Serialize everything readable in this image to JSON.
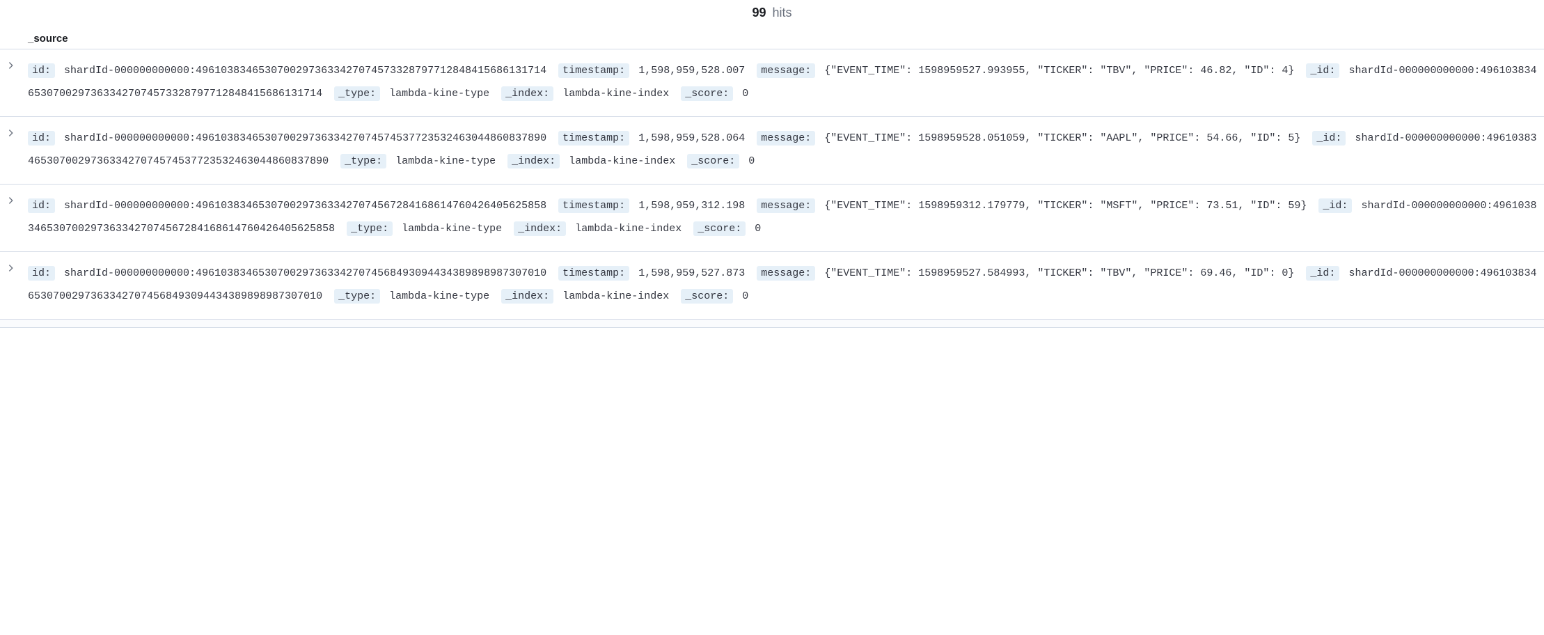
{
  "header": {
    "hits_count": "99",
    "hits_label": "hits"
  },
  "columns": {
    "source": "_source"
  },
  "rows": [
    {
      "id_label": "id:",
      "id_value": "shardId-000000000000:49610383465307002973633427074573328797712848415686131714",
      "timestamp_label": "timestamp:",
      "timestamp_value": "1,598,959,528.007",
      "message_label": "message:",
      "message_value": "{\"EVENT_TIME\": 1598959527.993955, \"TICKER\": \"TBV\", \"PRICE\": 46.82, \"ID\": 4}",
      "underscore_id_label": "_id:",
      "underscore_id_value": "shardId-000000000000:49610383465307002973633427074573328797712848415686131714",
      "type_label": "_type:",
      "type_value": "lambda-kine-type",
      "index_label": "_index:",
      "index_value": "lambda-kine-index",
      "score_label": "_score:",
      "score_value": "0"
    },
    {
      "id_label": "id:",
      "id_value": "shardId-000000000000:49610383465307002973633427074574537723532463044860837890",
      "timestamp_label": "timestamp:",
      "timestamp_value": "1,598,959,528.064",
      "message_label": "message:",
      "message_value": "{\"EVENT_TIME\": 1598959528.051059, \"TICKER\": \"AAPL\", \"PRICE\": 54.66, \"ID\": 5}",
      "underscore_id_label": "_id:",
      "underscore_id_value": "shardId-000000000000:49610383465307002973633427074574537723532463044860837890",
      "type_label": "_type:",
      "type_value": "lambda-kine-type",
      "index_label": "_index:",
      "index_value": "lambda-kine-index",
      "score_label": "_score:",
      "score_value": "0"
    },
    {
      "id_label": "id:",
      "id_value": "shardId-000000000000:49610383465307002973633427074567284168614760426405625858",
      "timestamp_label": "timestamp:",
      "timestamp_value": "1,598,959,312.198",
      "message_label": "message:",
      "message_value": "{\"EVENT_TIME\": 1598959312.179779, \"TICKER\": \"MSFT\", \"PRICE\": 73.51, \"ID\": 59}",
      "underscore_id_label": "_id:",
      "underscore_id_value": "shardId-000000000000:49610383465307002973633427074567284168614760426405625858",
      "type_label": "_type:",
      "type_value": "lambda-kine-type",
      "index_label": "_index:",
      "index_value": "lambda-kine-index",
      "score_label": "_score:",
      "score_value": "0"
    },
    {
      "id_label": "id:",
      "id_value": "shardId-000000000000:49610383465307002973633427074568493094434389898987307010",
      "timestamp_label": "timestamp:",
      "timestamp_value": "1,598,959,527.873",
      "message_label": "message:",
      "message_value": "{\"EVENT_TIME\": 1598959527.584993, \"TICKER\": \"TBV\", \"PRICE\": 69.46, \"ID\": 0}",
      "underscore_id_label": "_id:",
      "underscore_id_value": "shardId-000000000000:49610383465307002973633427074568493094434389898987307010",
      "type_label": "_type:",
      "type_value": "lambda-kine-type",
      "index_label": "_index:",
      "index_value": "lambda-kine-index",
      "score_label": "_score:",
      "score_value": "0"
    }
  ]
}
